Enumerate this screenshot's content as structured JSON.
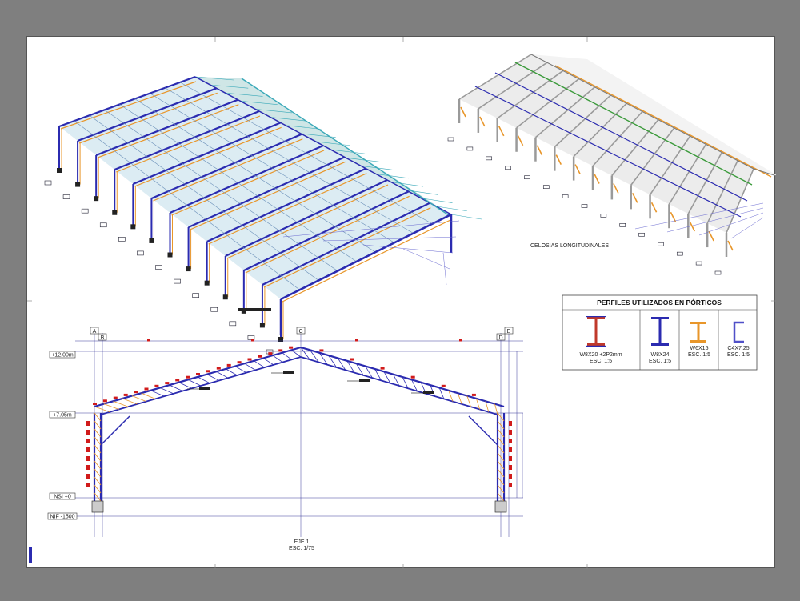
{
  "sheet": {
    "axis_labels": [
      "A",
      "B",
      "C",
      "D",
      "E"
    ],
    "levels": [
      "+12.00m",
      "+7.05m",
      "NSI +0",
      "NIF -1500"
    ],
    "section_title": "EJE 1",
    "section_scale": "ESC. 1/75",
    "iso_right_caption": "CELOSIAS LONGITUDINALES"
  },
  "profiles": {
    "title": "PERFILES UTILIZADOS EN PÓRTICOS",
    "items": [
      {
        "name": "W8X20 +2P2mm",
        "scale": "ESC. 1:5",
        "color": "#c0392b"
      },
      {
        "name": "W8X24",
        "scale": "ESC. 1:5",
        "color": "#2b2bb0"
      },
      {
        "name": "W6X15",
        "scale": "ESC. 1:5",
        "color": "#e8962a"
      },
      {
        "name": "C4X7.25",
        "scale": "ESC. 1:5",
        "color": "#5050c8"
      }
    ]
  },
  "colors": {
    "steel_blue": "#2b2bb0",
    "truss_orange": "#e8962a",
    "purlin_red": "#d11b1b",
    "roof_cyan": "#38a8b8",
    "gray_frame": "#9a9a9a",
    "green": "#3a9a3a"
  }
}
